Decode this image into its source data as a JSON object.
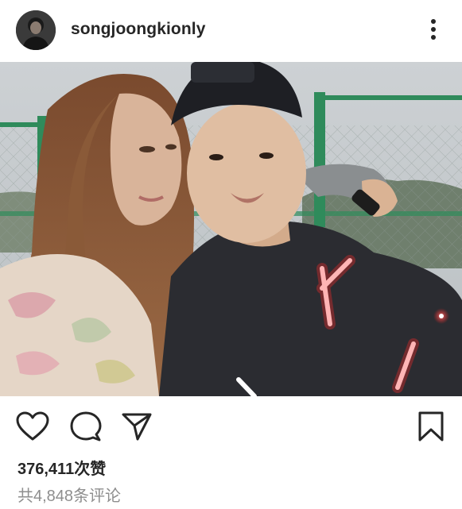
{
  "post": {
    "username": "songjoongkionly",
    "likes_text": "376,411次赞",
    "comments_text": "共4,848条评论"
  },
  "icons": {
    "more": "more-options-icon",
    "like": "heart-icon",
    "comment": "comment-icon",
    "share": "send-icon",
    "save": "bookmark-icon"
  },
  "colors": {
    "text": "#262626",
    "secondary_text": "#8e8e8e",
    "background": "#ffffff"
  }
}
